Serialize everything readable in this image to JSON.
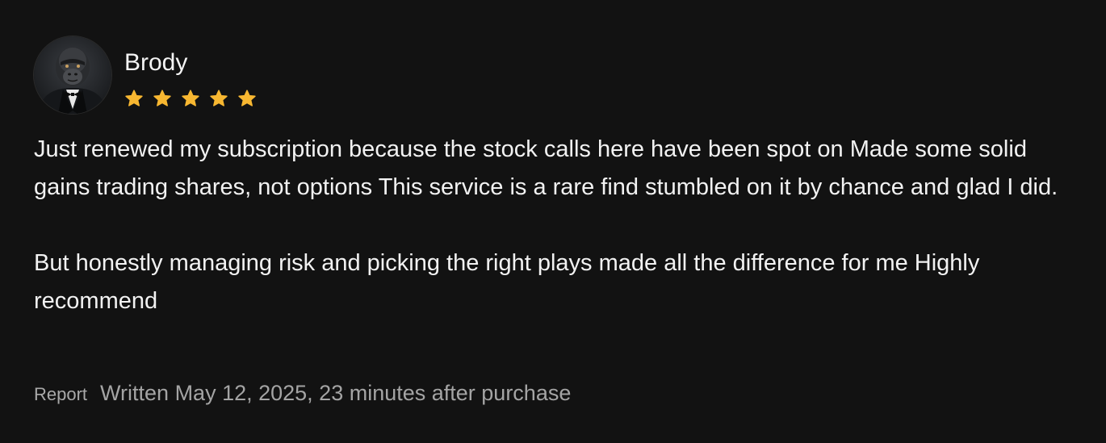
{
  "review": {
    "author": "Brody",
    "rating": 5,
    "rating_max": 5,
    "star_color": "#F7B731",
    "paragraphs": [
      "Just renewed my subscription because the stock calls here have been spot on Made some solid gains trading shares, not options This service is a rare find stumbled on it by chance and glad I did.",
      "But honestly managing risk and picking the right plays made all the difference for me Highly recommend"
    ],
    "report_label": "Report",
    "written_text": "Written May 12, 2025, 23 minutes after purchase"
  },
  "icons": {
    "avatar": "gorilla-in-tuxedo-avatar",
    "star": "star-icon"
  }
}
